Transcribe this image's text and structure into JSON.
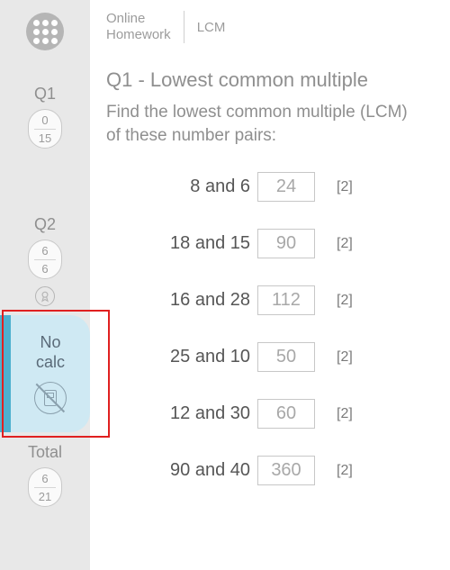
{
  "header": {
    "crumb1_line1": "Online",
    "crumb1_line2": "Homework",
    "crumb2": "LCM"
  },
  "sidebar": {
    "q1": {
      "label": "Q1",
      "got": "0",
      "out_of": "15"
    },
    "q2": {
      "label": "Q2",
      "got": "6",
      "out_of": "6"
    },
    "nocalc": {
      "line1": "No",
      "line2": "calc"
    },
    "total": {
      "label": "Total",
      "got": "6",
      "out_of": "21"
    }
  },
  "main": {
    "title": "Q1 - Lowest common multiple",
    "prompt": "Find the lowest common multiple (LCM) of these number pairs:",
    "rows": [
      {
        "pair": "8 and 6",
        "answer": "24",
        "marks": "[2]"
      },
      {
        "pair": "18 and 15",
        "answer": "90",
        "marks": "[2]"
      },
      {
        "pair": "16 and 28",
        "answer": "112",
        "marks": "[2]"
      },
      {
        "pair": "25 and 10",
        "answer": "50",
        "marks": "[2]"
      },
      {
        "pair": "12 and 30",
        "answer": "60",
        "marks": "[2]"
      },
      {
        "pair": "90 and 40",
        "answer": "360",
        "marks": "[2]"
      }
    ]
  }
}
